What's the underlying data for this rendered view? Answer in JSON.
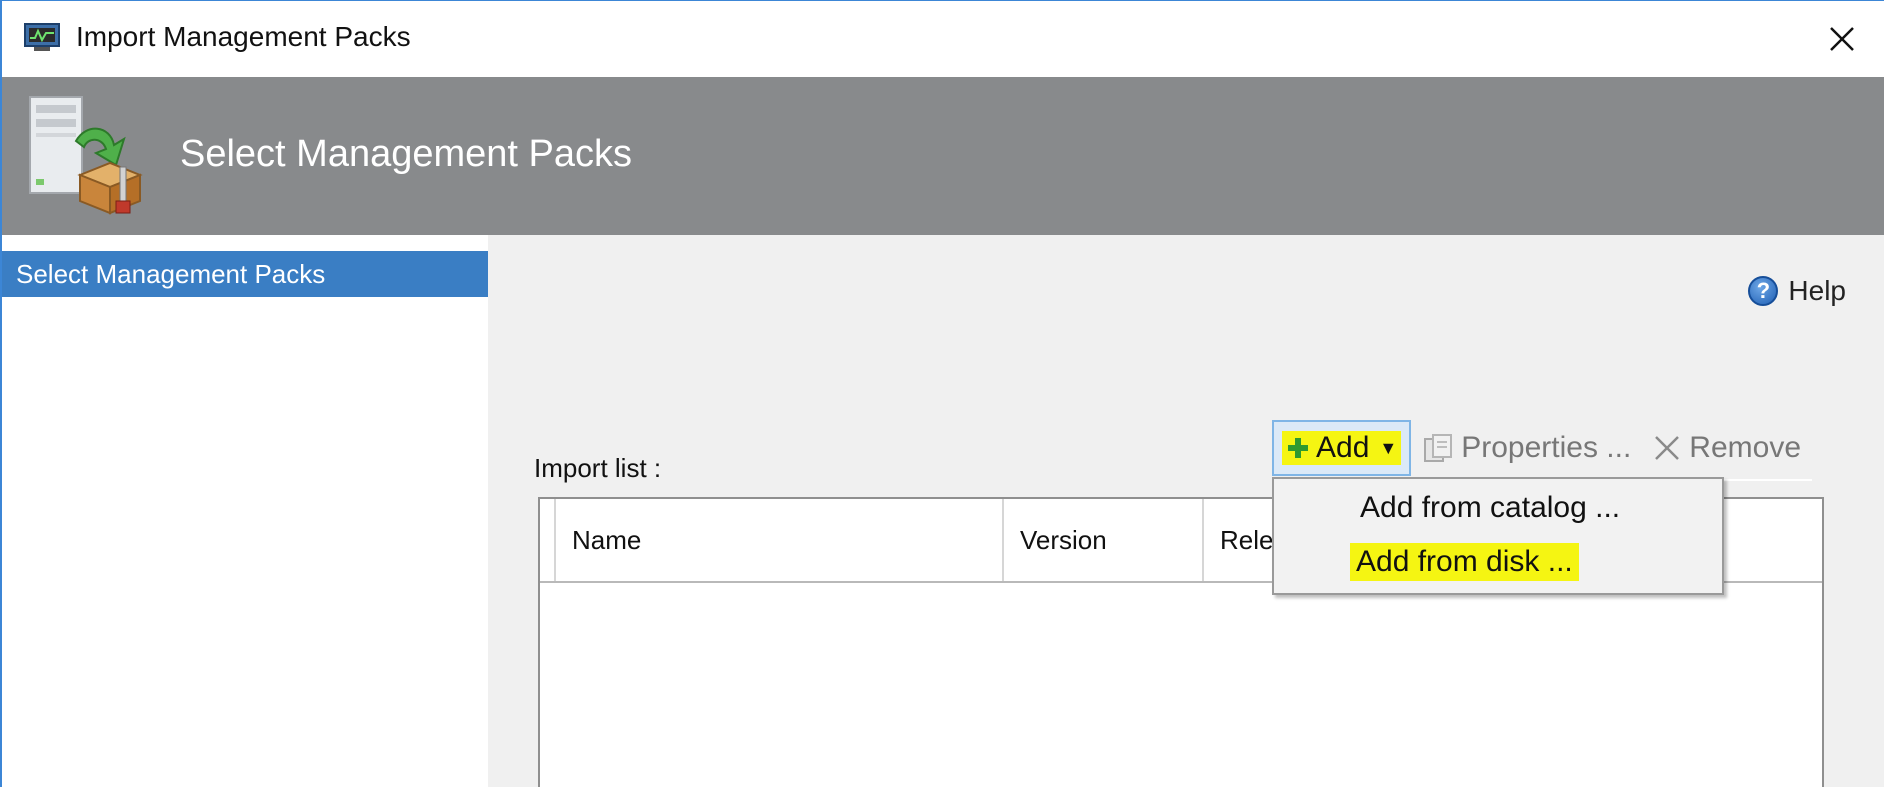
{
  "window": {
    "title": "Import Management Packs",
    "accent_color": "#3c86d6"
  },
  "header": {
    "title": "Select Management Packs",
    "background_color": "#888a8c"
  },
  "sidebar": {
    "items": [
      {
        "label": "Select Management Packs",
        "selected": true,
        "color": "#3a7ec4"
      }
    ]
  },
  "main": {
    "help_label": "Help",
    "import_list_label": "Import list :",
    "toolbar": {
      "add_label": "Add",
      "properties_label": "Properties ...",
      "remove_label": "Remove"
    },
    "grid": {
      "columns": [
        "Name",
        "Version",
        "Rele"
      ],
      "rows": []
    },
    "add_menu": {
      "items": [
        "Add from catalog ...",
        "Add from disk ..."
      ],
      "highlight_color": "#f5f512"
    }
  },
  "icons": {
    "app": "monitor-icon",
    "close": "close-icon",
    "banner": "import-package-icon",
    "help": "help-icon",
    "add": "plus-icon",
    "properties": "properties-icon",
    "remove": "remove-x-icon"
  }
}
